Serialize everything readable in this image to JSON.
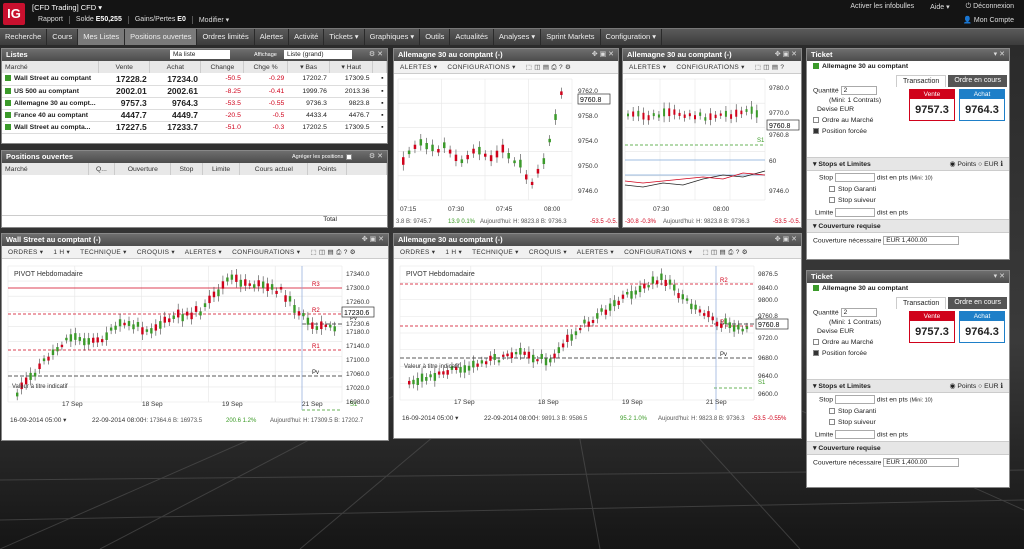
{
  "topbar": {
    "logo": "IG",
    "account_title": "[CFD Trading] CFD ▾",
    "rapport": "Rapport",
    "solde_label": "Solde",
    "solde_value": "E50,255",
    "gains_label": "Gains/Pertes",
    "gains_value": "E0",
    "modifier": "Modifier ▾",
    "infobulles": "Activer les infobulles",
    "aide": "Aide ▾",
    "deconnexion": "Déconnexion",
    "mon_compte": "Mon Compte"
  },
  "nav": [
    "Recherche",
    "Cours",
    "Mes Listes",
    "Positions ouvertes",
    "Ordres limités",
    "Alertes",
    "Activité",
    "Tickets ▾",
    "Graphiques ▾",
    "Outils",
    "Actualités",
    "Analyses ▾",
    "Sprint Markets",
    "Configuration ▾"
  ],
  "listes": {
    "title": "Listes",
    "select1": "Ma liste",
    "affichage_label": "Affichage",
    "select2": "Liste (grand)",
    "headers": [
      "Marché",
      "Vente",
      "Achat",
      "Change",
      "Chge %",
      "▾ Bas",
      "▾ Haut"
    ],
    "rows": [
      [
        "Wall Street au comptant",
        "17228.2",
        "17234.0",
        "-50.5",
        "-0.29",
        "17202.7",
        "17309.5"
      ],
      [
        "US 500 au comptant",
        "2002.01",
        "2002.61",
        "-8.25",
        "-0.41",
        "1999.76",
        "2013.36"
      ],
      [
        "Allemagne 30 au compt...",
        "9757.3",
        "9764.3",
        "-53.5",
        "-0.55",
        "9736.3",
        "9823.8"
      ],
      [
        "France 40 au comptant",
        "4447.7",
        "4449.7",
        "-20.5",
        "-0.5",
        "4433.4",
        "4476.7"
      ],
      [
        "Wall Street au compta...",
        "17227.5",
        "17233.7",
        "-51.0",
        "-0.3",
        "17202.5",
        "17309.5"
      ]
    ]
  },
  "positions": {
    "title": "Positions ouvertes",
    "group_label": "Agréger les positions",
    "headers": [
      "Marché",
      "Q...",
      "Ouverture",
      "Stop",
      "Limite",
      "Cours actuel",
      "Points"
    ],
    "total": "Total"
  },
  "chart_tl": {
    "title": "Allemagne 30 au comptant (-)",
    "tools": [
      "ALERTES ▾",
      "CONFIGURATIONS ▾"
    ],
    "yticks": [
      "9762.0",
      "9758.0",
      "9754.0",
      "9750.0",
      "9746.0"
    ],
    "price": "9760.8",
    "xticks": [
      "07:15",
      "07:30",
      "07:45",
      "08:00"
    ],
    "status_pre": "3.8 B: 9745.7",
    "status_chg": "13.9 0.1%",
    "status_mid": "Aujourd'hui: H: 9823.8 B: 9736.3",
    "status_neg": "-53.5 -0.5..."
  },
  "chart_tr": {
    "title": "Allemagne 30 au comptant (-)",
    "tools": [
      "ALERTES ▾",
      "CONFIGURATIONS ▾"
    ],
    "yticks": [
      "9780.0",
      "9770.0",
      "9760.8",
      "60",
      "9746.0"
    ],
    "price": "9760.8",
    "s1": "S1",
    "xticks": [
      "07:30",
      "08:00"
    ],
    "status": "-30.8 -0.3%",
    "status2": "Aujourd'hui: H: 9823.8 B: 9736.3",
    "status_neg": "-53.5 -0.5..."
  },
  "chart_bl": {
    "title": "Wall Street au comptant (-)",
    "tools": [
      "ORDRES ▾",
      "1 H ▾",
      "TECHNIQUE ▾",
      "CROQUIS ▾",
      "ALERTES ▾",
      "CONFIGURATIONS ▾"
    ],
    "pivot": "PIVOT Hebdomadaire",
    "yticks": [
      "17340.0",
      "17300.0",
      "17260.0",
      "17230.6",
      "17180.0",
      "17140.0",
      "17100.0",
      "17060.0",
      "17020.0",
      "16980.0"
    ],
    "price": "17230.6",
    "labels": {
      "r3": "R3",
      "r2": "R2",
      "r1": "R1",
      "pv": "Pv",
      "s1": "S1"
    },
    "xticks": [
      "17 Sep",
      "18 Sep",
      "19 Sep",
      "21 Sep"
    ],
    "indicatif": "Valeur à titre indicatif",
    "date_from": "16-09-2014 05:00",
    "date_to": "22-09-2014 08:00",
    "status_hb": "H: 17364.6 B: 16973.5",
    "status_chg": "200.6 1.2%",
    "status_mid": "Aujourd'hui: H: 17309.5 B: 17202.7"
  },
  "chart_bm": {
    "title": "Allemagne 30 au comptant (-)",
    "tools": [
      "ORDRES ▾",
      "1 H ▾",
      "TECHNIQUE ▾",
      "CROQUIS ▾",
      "ALERTES ▾",
      "CONFIGURATIONS ▾"
    ],
    "pivot": "PIVOT Hebdomadaire",
    "yticks": [
      "9876.5",
      "9840.0",
      "9800.0",
      "9760.8",
      "9720.0",
      "9680.0",
      "9640.0",
      "9600.0"
    ],
    "price": "9760.8",
    "labels": {
      "r2": "R2",
      "r1": "R1",
      "pv": "Pv",
      "s1": "S1"
    },
    "xticks": [
      "17 Sep",
      "18 Sep",
      "19 Sep",
      "21 Sep"
    ],
    "indicatif": "Valeur à titre indicatif",
    "date_from": "16-09-2014 05:00",
    "date_to": "22-09-2014 08:00",
    "status_hb": "H: 9891.3 B: 9586.5",
    "status_chg": "95.2 1.0%",
    "status_mid": "Aujourd'hui: H: 9823.8 B: 9736.3",
    "status_neg": "-53.5 -0.55%"
  },
  "tickets": [
    {
      "title": "Ticket",
      "market": "Allemagne 30 au comptant",
      "tab1": "Transaction",
      "tab2": "Ordre en cours",
      "qty_label": "Quantité",
      "qty": "2",
      "min": "(Mini: 1 Contrats)",
      "devise_label": "Devise",
      "devise": "EUR",
      "ordre_marche": "Ordre au Marché",
      "position_forcee": "Position forcée",
      "sell_label": "Vente",
      "sell": "9757.3",
      "buy_label": "Achat",
      "buy": "9764.3",
      "stops_title": "Stops et Limites",
      "points": "Points",
      "eur": "EUR",
      "stop_label": "Stop",
      "dist_pts": "dist en pts",
      "mini10": "(Mini: 10)",
      "stop_garanti": "Stop Garanti",
      "stop_suiveur": "Stop suiveur",
      "limite_label": "Limite",
      "dist_pts2": "dist en pts",
      "couv_title": "Couverture requise",
      "couv_label": "Couverture nécessaire",
      "couv_value": "EUR 1,400.00"
    },
    {
      "title": "Ticket",
      "market": "Allemagne 30 au comptant",
      "tab1": "Transaction",
      "tab2": "Ordre en cours",
      "qty_label": "Quantité",
      "qty": "2",
      "min": "(Mini: 1 Contrats)",
      "devise_label": "Devise",
      "devise": "EUR",
      "ordre_marche": "Ordre au Marché",
      "position_forcee": "Position forcée",
      "sell_label": "Vente",
      "sell": "9757.3",
      "buy_label": "Achat",
      "buy": "9764.3",
      "stops_title": "Stops et Limites",
      "points": "Points",
      "eur": "EUR",
      "stop_label": "Stop",
      "dist_pts": "dist en pts",
      "mini10": "(Mini: 10)",
      "stop_garanti": "Stop Garanti",
      "stop_suiveur": "Stop suiveur",
      "limite_label": "Limite",
      "dist_pts2": "dist en pts",
      "couv_title": "Couverture requise",
      "couv_label": "Couverture nécessaire",
      "couv_value": "EUR 1,400.00"
    }
  ],
  "colors": {
    "sell": "#d0021b",
    "buy": "#1e7fc8",
    "up": "#3b9a2a",
    "down": "#d0021b"
  }
}
